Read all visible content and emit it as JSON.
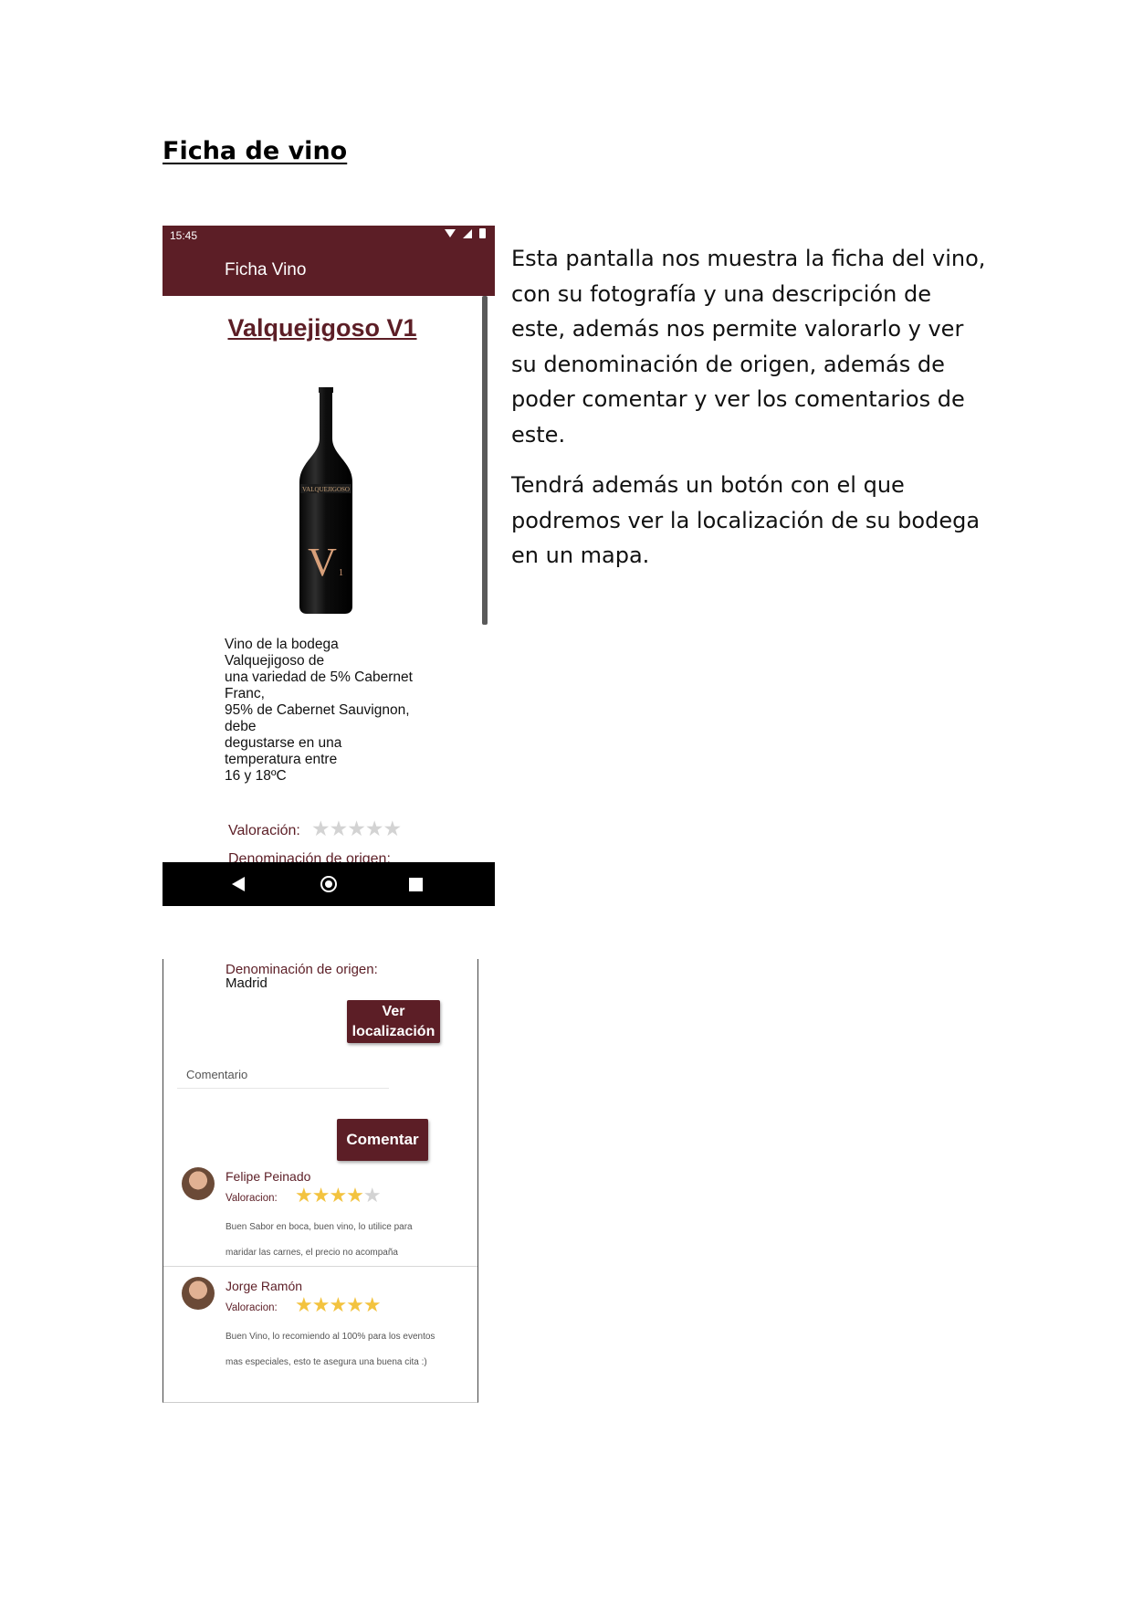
{
  "document": {
    "title": "Ficha de vino",
    "paragraphs": [
      "Esta pantalla nos muestra la ficha del vino, con su fotografía y una descripción de este, además nos permite valorarlo y ver su denominación de origen, además de poder comentar y ver los comentarios de este.",
      "Tendrá además un botón con el que podremos ver la localización de su bodega en un mapa."
    ]
  },
  "screen1": {
    "status_time": "15:45",
    "app_title": "Ficha Vino",
    "wine_name": "Valquejigoso V1",
    "label_text": "VALQUEJIGOSO",
    "label_mark": "V",
    "label_sub": "1",
    "description": "Vino de la bodega\nValquejigoso de\nuna variedad de 5% Cabernet\nFranc,\n95% de Cabernet Sauvignon,\ndebe\ndegustarse en una\ntemperatura entre\n16 y 18ºC",
    "rating_label": "Valoración:",
    "rating_stars": "★★★★★",
    "denomination_cut": "Denominación de origen:"
  },
  "screen2": {
    "denomination_label": "Denominación de origen:",
    "denomination_value": "Madrid",
    "location_button": "Ver localización",
    "comment_placeholder": "Comentario",
    "comment_button": "Comentar",
    "reviews": [
      {
        "name": "Felipe Peinado",
        "rating_label": "Valoracion:",
        "stars_on": "★★★★",
        "stars_off": "★",
        "rating": 4,
        "text": "Buen Sabor en boca, buen vino, lo utilice para\nmaridar las carnes, el precio no acompaña"
      },
      {
        "name": "Jorge Ramón",
        "rating_label": "Valoracion:",
        "stars_on": "★★★★★",
        "stars_off": "",
        "rating": 5,
        "text": "Buen Vino, lo recomiendo al 100% para los eventos\nmas especiales, esto te asegura una buena cita :)"
      }
    ]
  },
  "colors": {
    "brand": "#5c1e26",
    "star": "#f3c33f",
    "star_empty": "#d3d3d3"
  }
}
